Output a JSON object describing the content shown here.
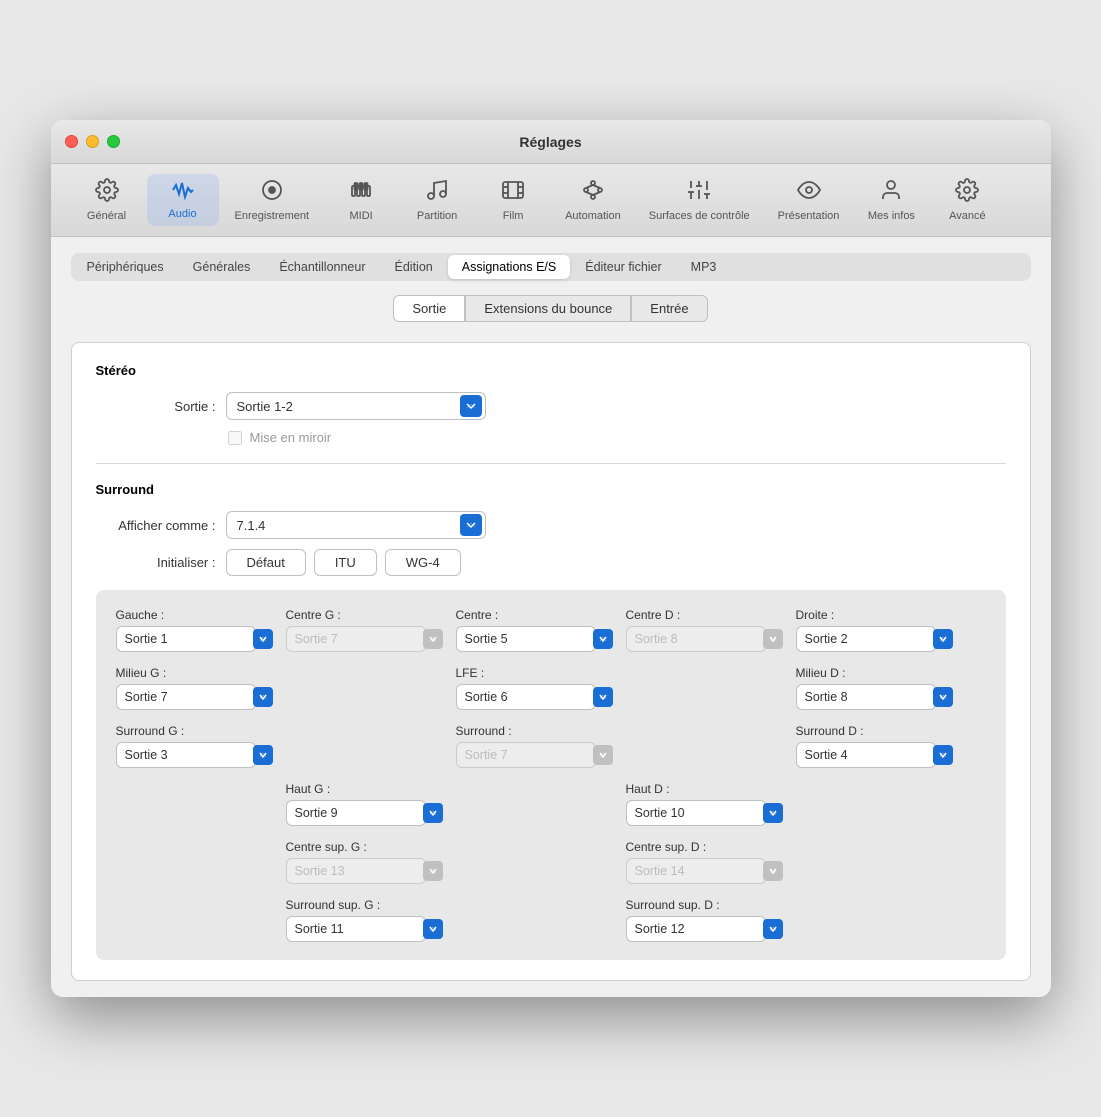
{
  "window": {
    "title": "Réglages"
  },
  "toolbar": {
    "items": [
      {
        "id": "general",
        "label": "Général",
        "icon": "⚙️"
      },
      {
        "id": "audio",
        "label": "Audio",
        "icon": "🔊",
        "active": true
      },
      {
        "id": "recording",
        "label": "Enregistrement",
        "icon": "⏺"
      },
      {
        "id": "midi",
        "label": "MIDI",
        "icon": "🎵"
      },
      {
        "id": "partition",
        "label": "Partition",
        "icon": "🎼"
      },
      {
        "id": "film",
        "label": "Film",
        "icon": "🎞️"
      },
      {
        "id": "automation",
        "label": "Automation",
        "icon": "✂️"
      },
      {
        "id": "surfaces",
        "label": "Surfaces de contrôle",
        "icon": "🎛️"
      },
      {
        "id": "presentation",
        "label": "Présentation",
        "icon": "👁️"
      },
      {
        "id": "mesinfos",
        "label": "Mes infos",
        "icon": "👤"
      },
      {
        "id": "avance",
        "label": "Avancé",
        "icon": "⚙️"
      }
    ]
  },
  "tabs": {
    "items": [
      {
        "id": "peripheriques",
        "label": "Périphériques"
      },
      {
        "id": "generales",
        "label": "Générales"
      },
      {
        "id": "echantillonneur",
        "label": "Échantillonneur"
      },
      {
        "id": "edition",
        "label": "Édition"
      },
      {
        "id": "assignations",
        "label": "Assignations E/S",
        "active": true
      },
      {
        "id": "editeur",
        "label": "Éditeur fichier"
      },
      {
        "id": "mp3",
        "label": "MP3"
      }
    ]
  },
  "subtabs": {
    "items": [
      {
        "id": "sortie",
        "label": "Sortie",
        "active": true
      },
      {
        "id": "extensions",
        "label": "Extensions du bounce"
      },
      {
        "id": "entree",
        "label": "Entrée"
      }
    ]
  },
  "stereo": {
    "title": "Stéréo",
    "sortie_label": "Sortie :",
    "sortie_value": "Sortie 1-2",
    "miroir_label": "Mise en miroir"
  },
  "surround": {
    "title": "Surround",
    "afficher_label": "Afficher comme :",
    "afficher_value": "7.1.4",
    "initialiser_label": "Initialiser :",
    "init_buttons": [
      "Défaut",
      "ITU",
      "WG-4"
    ],
    "channels": {
      "gauche": {
        "label": "Gauche :",
        "value": "Sortie 1",
        "disabled": false
      },
      "centre_g": {
        "label": "Centre G :",
        "value": "Sortie 7",
        "disabled": true
      },
      "centre": {
        "label": "Centre :",
        "value": "Sortie 5",
        "disabled": false
      },
      "centre_d": {
        "label": "Centre D :",
        "value": "Sortie 8",
        "disabled": true
      },
      "droite": {
        "label": "Droite :",
        "value": "Sortie 2",
        "disabled": false
      },
      "milieu_g": {
        "label": "Milieu G :",
        "value": "Sortie 7",
        "disabled": false
      },
      "lfe": {
        "label": "LFE :",
        "value": "Sortie 6",
        "disabled": false
      },
      "milieu_d": {
        "label": "Milieu D :",
        "value": "Sortie 8",
        "disabled": false
      },
      "surround_g": {
        "label": "Surround G :",
        "value": "Sortie 3",
        "disabled": false
      },
      "surround": {
        "label": "Surround :",
        "value": "Sortie 7",
        "disabled": true
      },
      "surround_d": {
        "label": "Surround D :",
        "value": "Sortie 4",
        "disabled": false
      },
      "haut_g": {
        "label": "Haut G :",
        "value": "Sortie 9",
        "disabled": false
      },
      "haut_d": {
        "label": "Haut D :",
        "value": "Sortie 10",
        "disabled": false
      },
      "centre_sup_g": {
        "label": "Centre sup. G :",
        "value": "Sortie 13",
        "disabled": true
      },
      "centre_sup_d": {
        "label": "Centre sup. D :",
        "value": "Sortie 14",
        "disabled": true
      },
      "surround_sup_g": {
        "label": "Surround sup. G :",
        "value": "Sortie 11",
        "disabled": false
      },
      "surround_sup_d": {
        "label": "Surround sup. D :",
        "value": "Sortie 12",
        "disabled": false
      }
    }
  }
}
